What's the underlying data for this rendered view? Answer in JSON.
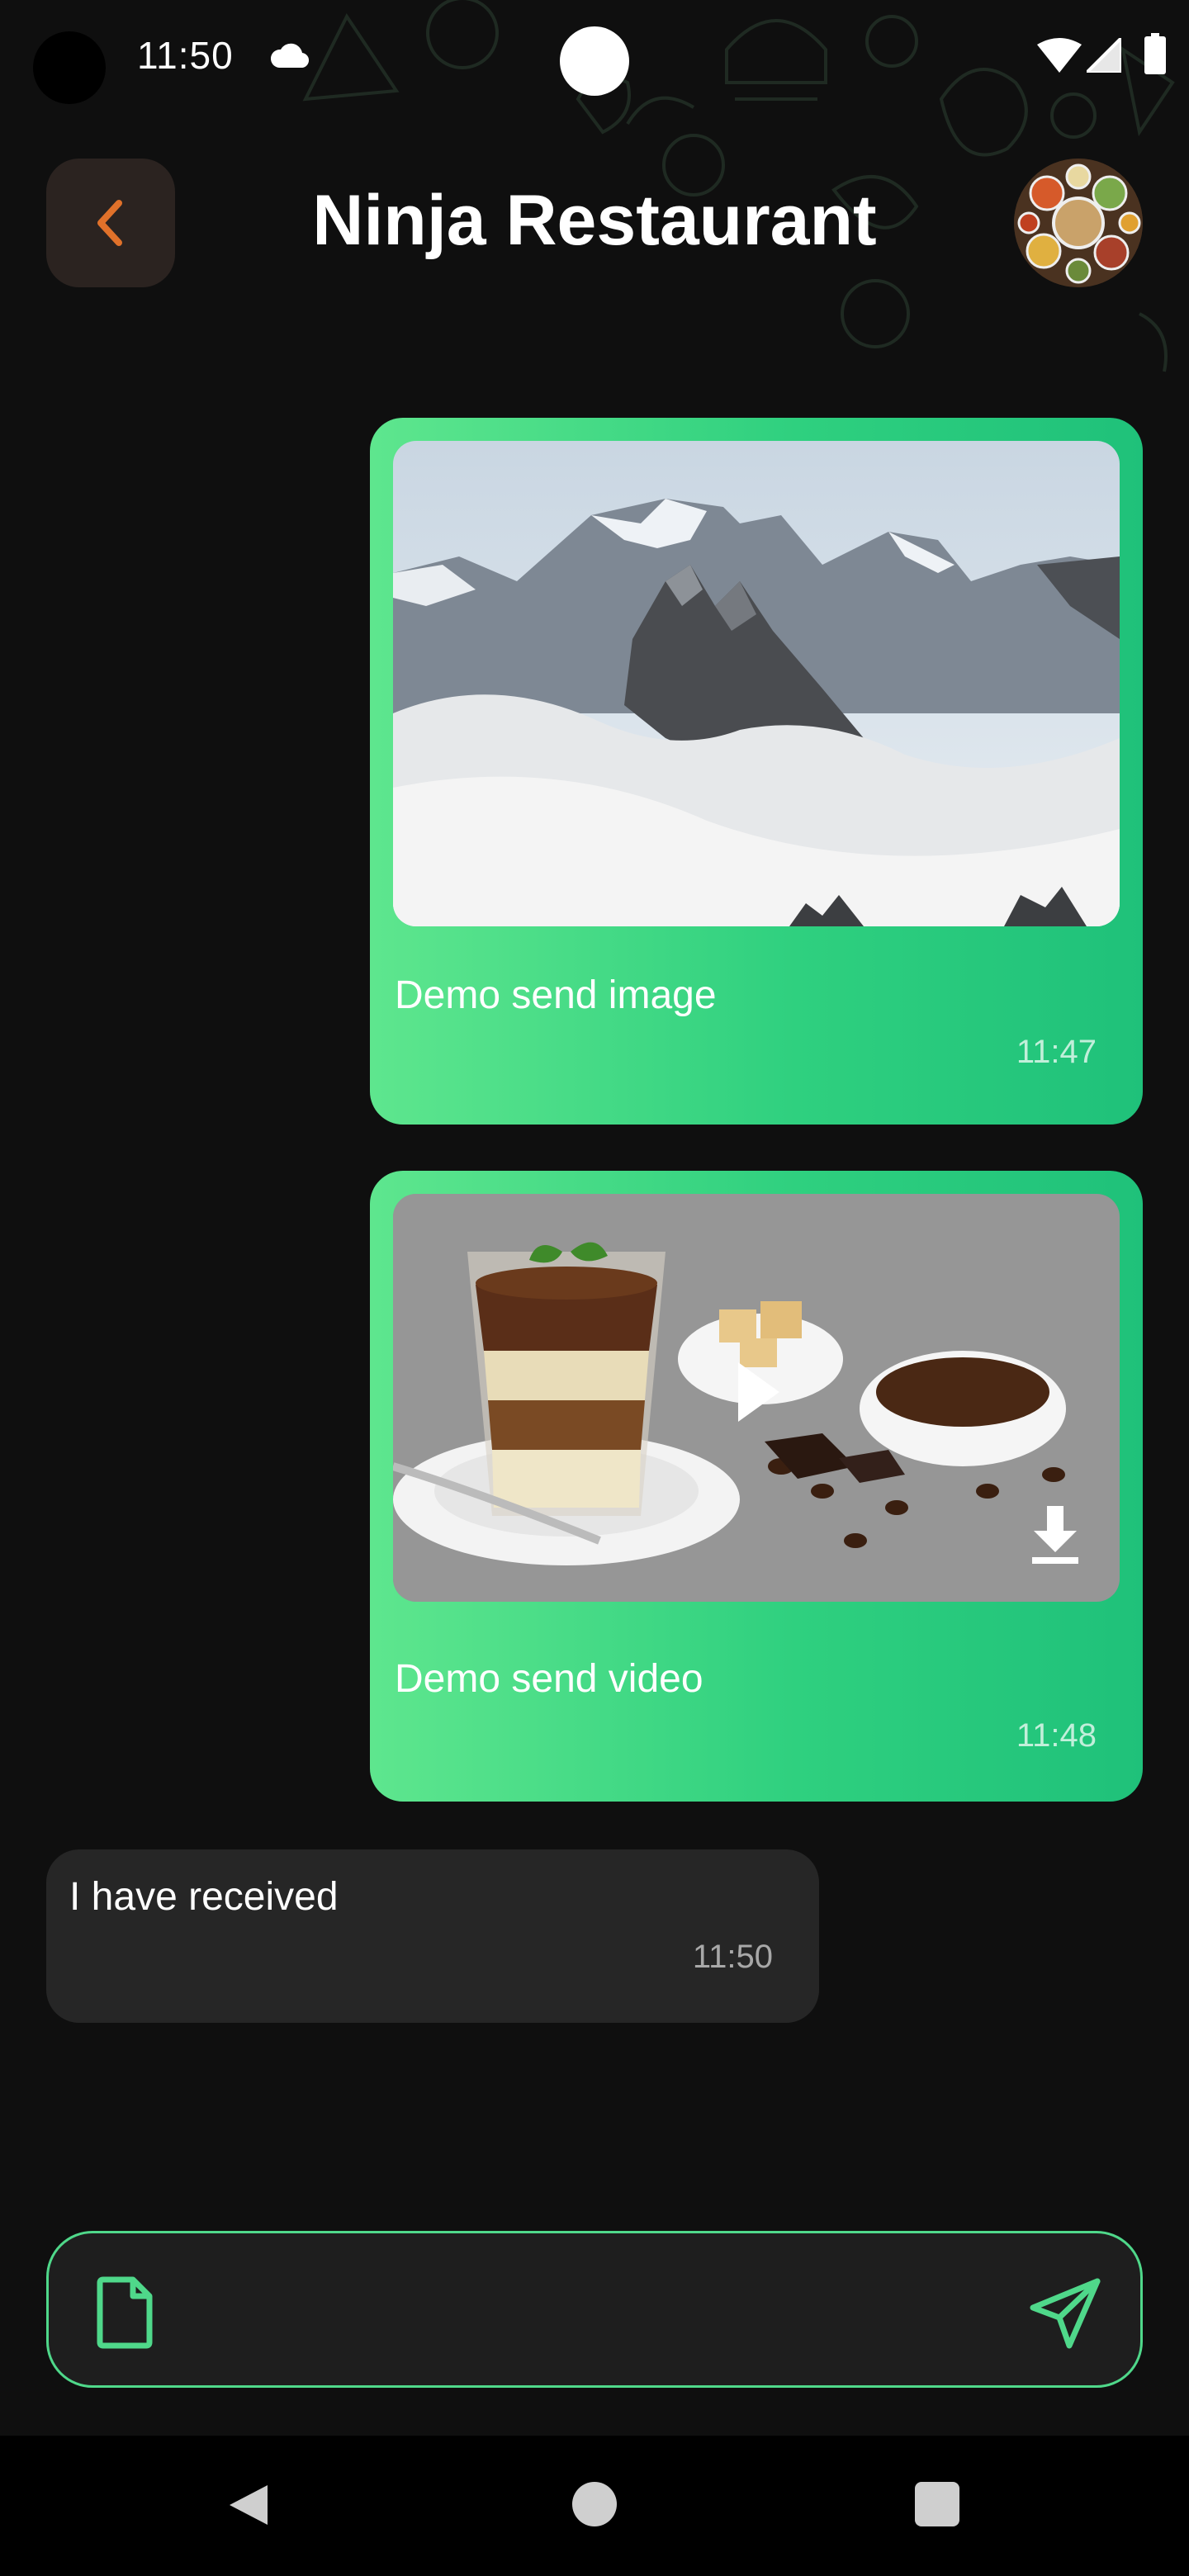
{
  "status_bar": {
    "time": "11:50"
  },
  "header": {
    "title": "Ninja Restaurant"
  },
  "messages": [
    {
      "direction": "sent",
      "type": "image",
      "text": "Demo send image",
      "time": "11:47"
    },
    {
      "direction": "sent",
      "type": "video",
      "text": "Demo send video",
      "time": "11:48"
    },
    {
      "direction": "received",
      "type": "text",
      "text": "I have received",
      "time": "11:50"
    }
  ],
  "composer": {
    "value": "",
    "placeholder": ""
  },
  "icons": {
    "back": "chevron-left-icon",
    "attach": "file-icon",
    "send": "paper-plane-icon",
    "play": "play-icon",
    "download": "download-icon"
  },
  "colors": {
    "background": "#0f0f0f",
    "accent_green": "#2fd07f",
    "back_accent": "#e0712a",
    "received_bubble": "#262626"
  }
}
